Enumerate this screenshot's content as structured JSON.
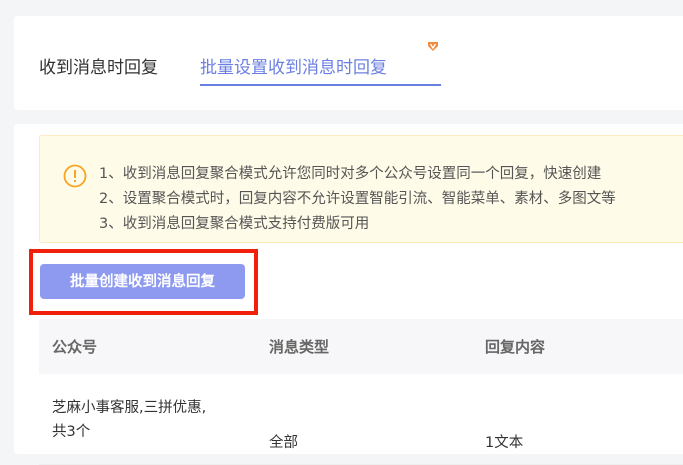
{
  "tabs": [
    {
      "label": "收到消息时回复",
      "active": false
    },
    {
      "label": "批量设置收到消息时回复",
      "active": true
    }
  ],
  "badge_icon": "vip-diamond-icon",
  "notice": {
    "icon": "warning-circle-icon",
    "lines": [
      "1、收到消息回复聚合模式允许您同时对多个公众号设置同一个回复，快速创建",
      "2、设置聚合模式时，回复内容不允许设置智能引流、智能菜单、素材、多图文等",
      "3、收到消息回复聚合模式支持付费版可用"
    ]
  },
  "create_button": "批量创建收到消息回复",
  "table": {
    "columns": [
      "公众号",
      "消息类型",
      "回复内容"
    ],
    "rows": [
      {
        "account_line1": "芝麻小事客服,三拼优惠,",
        "account_line2": "共3个",
        "type": "全部",
        "content": "1文本"
      }
    ]
  },
  "colors": {
    "accent": "#6b7fe0",
    "button": "#8e9af0",
    "highlight": "#f0200a",
    "notice_bg": "#fffbe9",
    "warning": "#f5a623",
    "badge": "#f08a3c"
  }
}
